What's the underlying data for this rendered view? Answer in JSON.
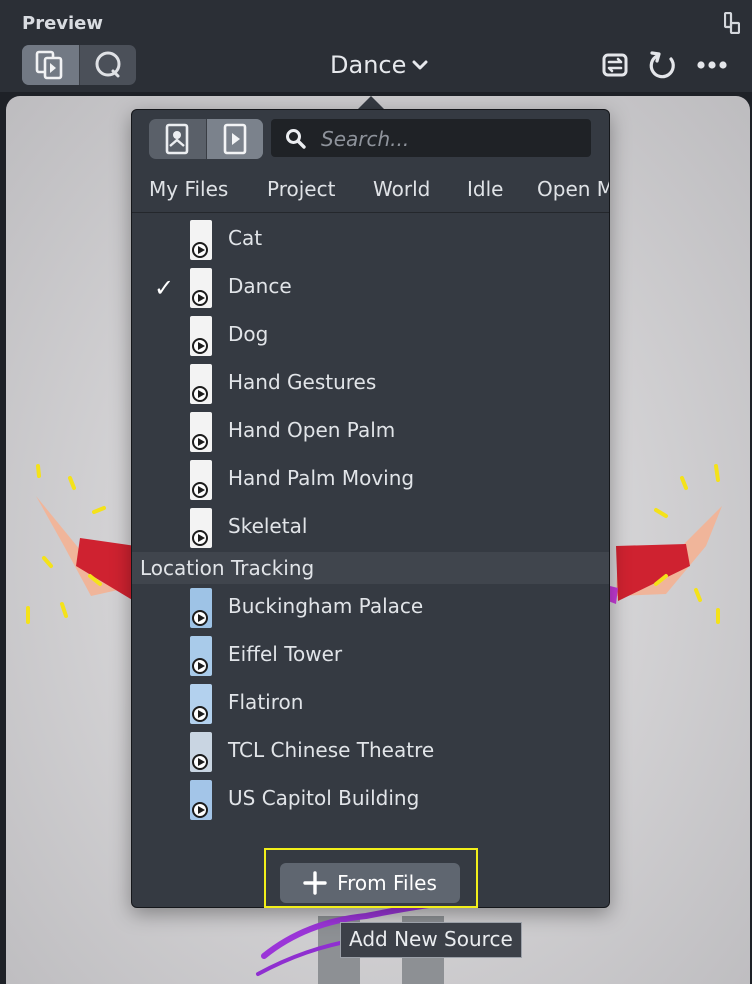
{
  "header": {
    "title": "Preview",
    "selected_source": "Dance"
  },
  "popover": {
    "search_placeholder": "Search...",
    "tabs": [
      "My Files",
      "Project",
      "World",
      "Idle",
      "Open M"
    ],
    "items": [
      {
        "label": "Cat",
        "checked": false
      },
      {
        "label": "Dance",
        "checked": true
      },
      {
        "label": "Dog",
        "checked": false
      },
      {
        "label": "Hand Gestures",
        "checked": false
      },
      {
        "label": "Hand Open Palm",
        "checked": false
      },
      {
        "label": "Hand Palm Moving",
        "checked": false
      },
      {
        "label": "Skeletal",
        "checked": false
      }
    ],
    "section_header": "Location Tracking",
    "location_items": [
      {
        "label": "Buckingham Palace"
      },
      {
        "label": "Eiffel Tower"
      },
      {
        "label": "Flatiron"
      },
      {
        "label": "TCL Chinese Theatre"
      },
      {
        "label": "US Capitol Building"
      }
    ],
    "from_files_label": "From Files",
    "checkmark": "✓"
  },
  "tooltip": "Add New Source",
  "colors": {
    "highlight": "#f2ef1a",
    "panel": "#353a42",
    "topbar": "#2b2f36"
  }
}
